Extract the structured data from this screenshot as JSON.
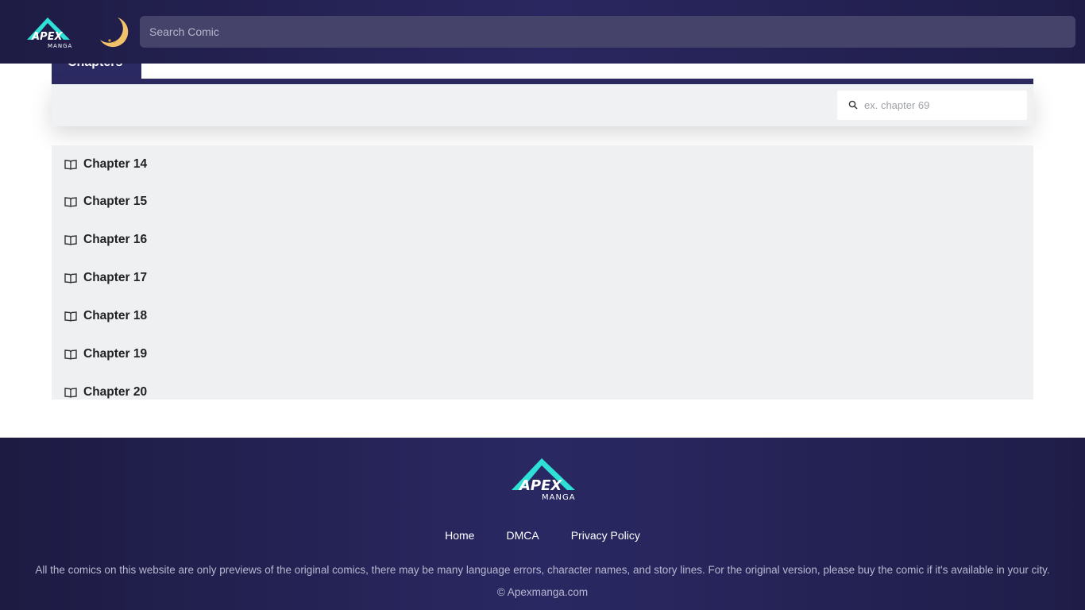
{
  "header": {
    "logo_text": "APEX",
    "logo_subtext": "MANGA",
    "moon_icon": "crescent-moon-icon",
    "search_placeholder": "Search Comic"
  },
  "chapters_tab": {
    "label": "Chapters"
  },
  "chapter_search": {
    "icon": "search-icon",
    "placeholder": "ex. chapter 69"
  },
  "chapters": [
    {
      "label": "Chapter 14",
      "icon": "book-open-icon"
    },
    {
      "label": "Chapter 15",
      "icon": "book-open-icon"
    },
    {
      "label": "Chapter 16",
      "icon": "book-open-icon"
    },
    {
      "label": "Chapter 17",
      "icon": "book-open-icon"
    },
    {
      "label": "Chapter 18",
      "icon": "book-open-icon"
    },
    {
      "label": "Chapter 19",
      "icon": "book-open-icon"
    },
    {
      "label": "Chapter 20",
      "icon": "book-open-icon"
    }
  ],
  "footer": {
    "logo_text": "APEX",
    "logo_subtext": "MANGA",
    "links": [
      {
        "label": "Home"
      },
      {
        "label": "DMCA"
      },
      {
        "label": "Privacy Policy"
      }
    ],
    "disclaimer": "All the comics on this website are only previews of the original comics, there may be many language errors, character names, and story lines. For the original version, please buy the comic if it's available in your city.",
    "copyright": "© Apexmanga.com"
  },
  "colors": {
    "header_bg": "#25234f",
    "accent_cyan": "#2fe0d6",
    "tab_bg": "#2c2a62",
    "list_bg": "#eff0f2"
  }
}
